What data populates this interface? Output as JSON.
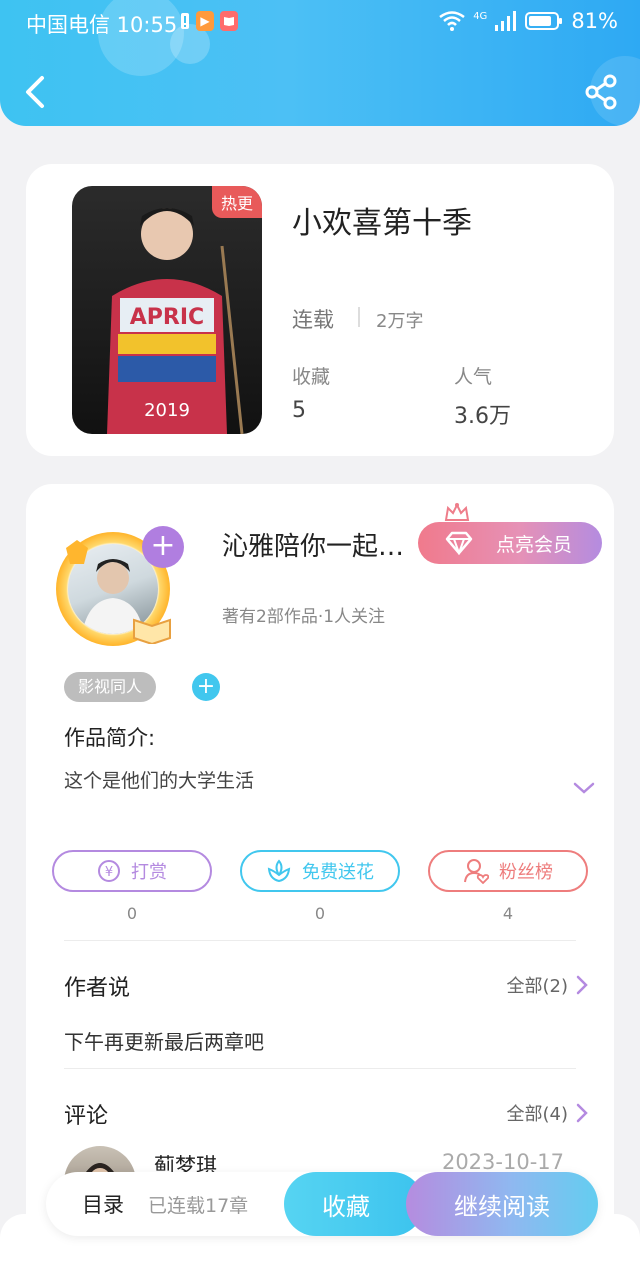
{
  "status_bar": {
    "carrier_time": "中国电信 10:55",
    "battery": "81%",
    "network": "4G"
  },
  "book": {
    "title": "小欢喜第十季",
    "badge": "热更",
    "status": "连载",
    "words": "2万字",
    "stats": [
      {
        "label": "收藏",
        "value": "5"
      },
      {
        "label": "人气",
        "value": "3.6万"
      }
    ]
  },
  "author": {
    "name": "沁雅陪你一起…",
    "meta": "著有2部作品·1人关注",
    "vip_button": "点亮会员",
    "tag": "影视同人"
  },
  "intro": {
    "title": "作品简介:",
    "text": "这个是他们的大学生活"
  },
  "actions": [
    {
      "label": "打赏",
      "count": "0",
      "color": "#b48ae0",
      "icon": "coin-icon"
    },
    {
      "label": "免费送花",
      "count": "0",
      "color": "#41c7ee",
      "icon": "flower-icon"
    },
    {
      "label": "粉丝榜",
      "count": "4",
      "color": "#ee7d7d",
      "icon": "fans-icon"
    }
  ],
  "author_says": {
    "title": "作者说",
    "all": "全部(2)",
    "text": "下午再更新最后两章吧"
  },
  "comments": {
    "title": "评论",
    "all": "全部(4)",
    "first": {
      "name": "蓟梦琪",
      "date": "2023-10-17"
    }
  },
  "bottom_bar": {
    "toc": "目录",
    "chapters": "已连载17章",
    "favorite": "收藏",
    "continue": "继续阅读"
  },
  "colors": {
    "header_blue": "#3ec3f2",
    "accent_purple": "#b07ee0",
    "accent_cyan": "#41c7ee"
  }
}
